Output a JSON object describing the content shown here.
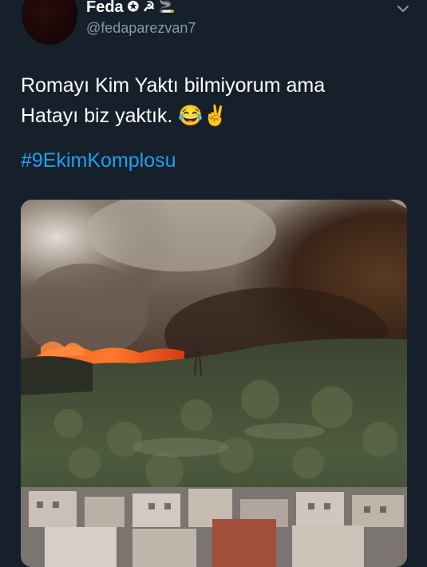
{
  "tweet": {
    "author_name": "Feda",
    "author_badges": [
      "✪",
      "☭",
      "☭",
      "🚬"
    ],
    "handle": "@fedaparezvan7",
    "text_lines": [
      "Romayı Kim Yaktı bilmiyorum ama",
      "Hatayı biz yaktık. 😂✌"
    ],
    "hashtag": "#9EkimKomplosu"
  },
  "icons": {
    "caret": "chevron-down-icon"
  },
  "colors": {
    "background": "#15202b",
    "hashtag": "#1da1f2",
    "secondary_text": "#8899a6"
  }
}
